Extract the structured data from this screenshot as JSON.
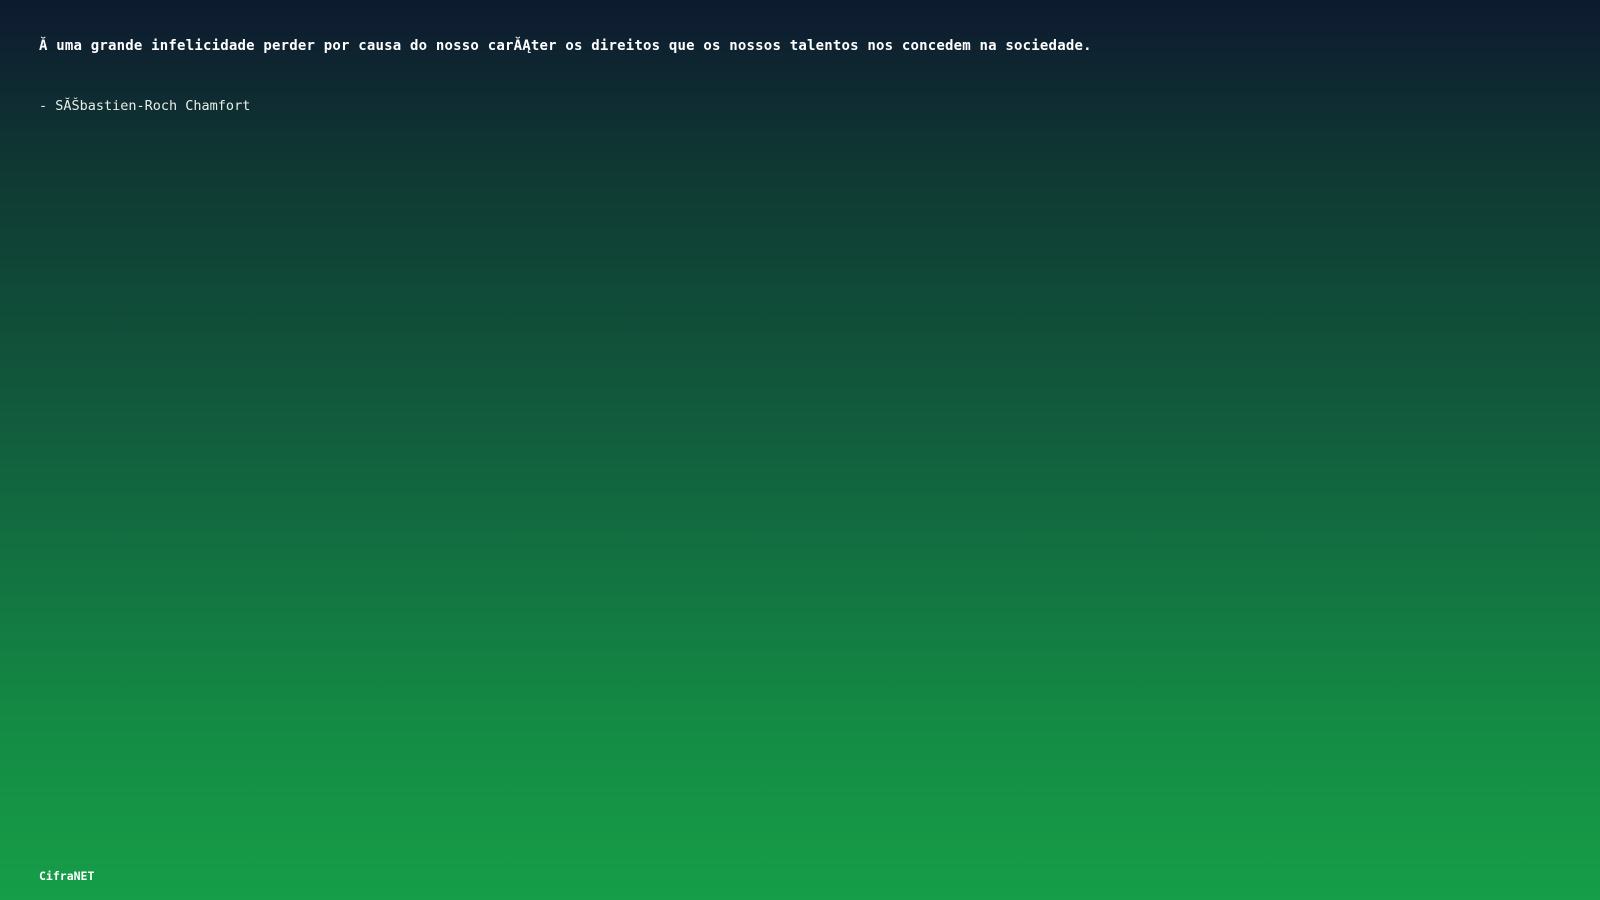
{
  "quote": {
    "text": "Ă  uma grande infelicidade perder por causa do nosso carĂĄter os direitos que os nossos talentos nos concedem na sociedade.",
    "author": "- SĂŠbastien-Roch Chamfort"
  },
  "footer": {
    "brand": "CifraNET"
  },
  "colors": {
    "gradient_top": "#0e1a2f",
    "gradient_bottom": "#169e48",
    "text": "#ffffff"
  }
}
